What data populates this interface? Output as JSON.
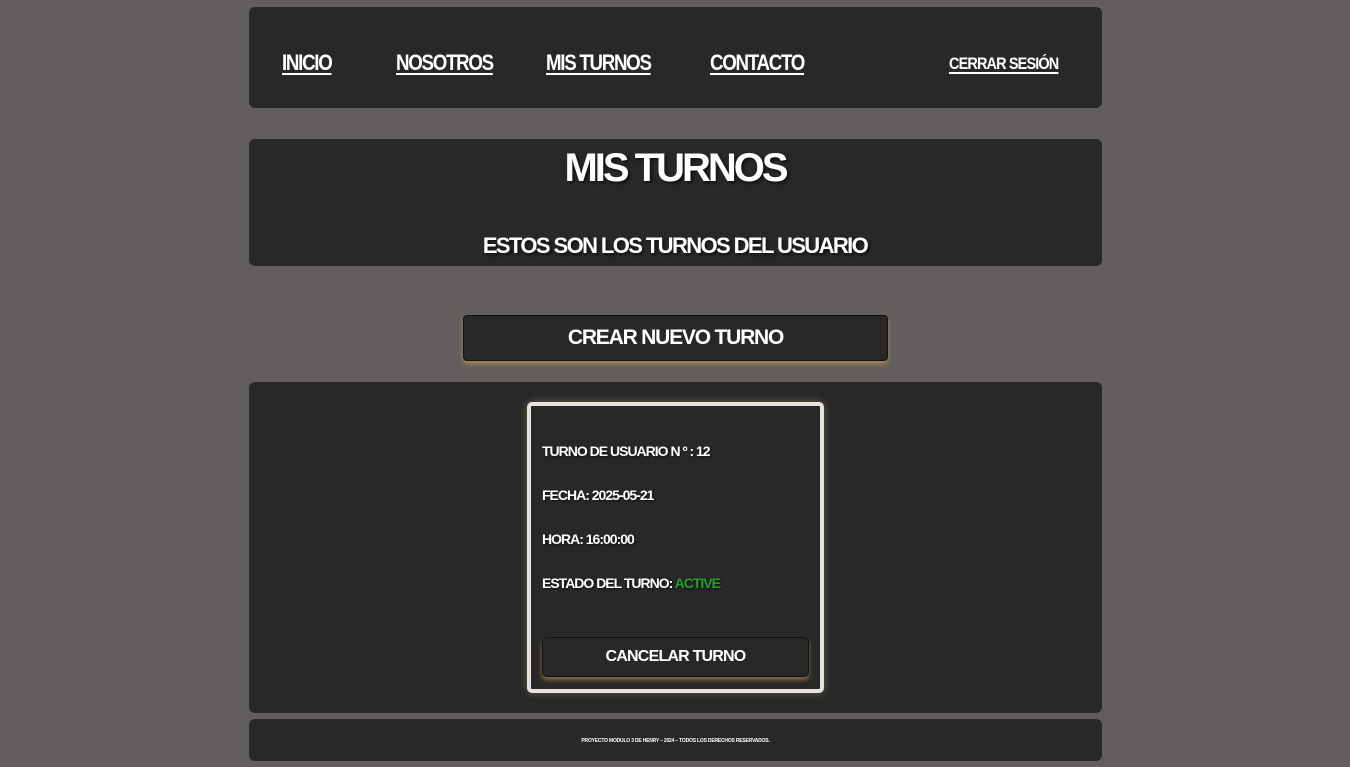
{
  "nav": {
    "inicio": "INICIO",
    "nosotros": "NOSOTROS",
    "mis_turnos": "MIS TURNOS",
    "contacto": "CONTACTO",
    "cerrar_sesion": "CERRAR SESIÓN"
  },
  "header": {
    "title": "MIS TURNOS",
    "subtitle": "ESTOS SON LOS TURNOS DEL USUARIO"
  },
  "actions": {
    "create_label": "CREAR NUEVO TURNO"
  },
  "turno": {
    "number_label": "TURNO DE USUARIO N º : 12",
    "fecha_label": "FECHA: 2025-05-21",
    "hora_label": "HORA: 16:00:00",
    "estado_label": "ESTADO DEL TURNO: ",
    "estado_value": "ACTIVE",
    "estado_color": "#1fa02a",
    "cancel_label": "CANCELAR TURNO"
  },
  "footer": {
    "text": "PROYECTO MODULO 3 DE HENRY – 2024 – TODOS LOS DERECHOS RESERVADOS."
  }
}
